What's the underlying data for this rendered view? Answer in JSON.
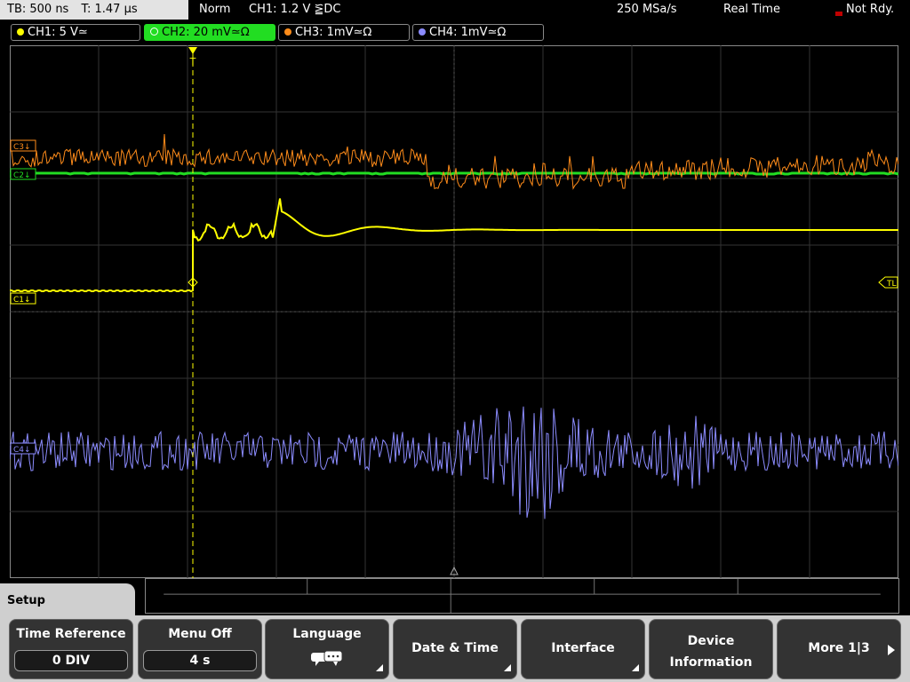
{
  "header": {
    "timebase": "TB: 500 ns",
    "trigger_time": "T: 1.47 µs",
    "mode": "Norm",
    "trigger": "CH1: 1.2 V ⪠DC",
    "sample_rate": "250 MSa/s",
    "acq_mode": "Real Time",
    "status": "Not Rdy."
  },
  "channels": [
    {
      "label": "CH1: 5 V≃",
      "color": "#ffff00"
    },
    {
      "label": "CH2: 20 mV≃Ω",
      "color": "#00ff00"
    },
    {
      "label": "CH3: 1mV≃Ω",
      "color": "#ff8c1a"
    },
    {
      "label": "CH4: 1mV≃Ω",
      "color": "#8c8cff"
    }
  ],
  "markers": {
    "c3": "C3↓",
    "c2": "C2↓",
    "c1": "C1↓",
    "c4": "C4↓",
    "tl": "TL",
    "trigger": "T"
  },
  "menu": {
    "title": "Setup",
    "softkeys": [
      {
        "label": "Time Reference",
        "value": "0 DIV"
      },
      {
        "label": "Menu Off",
        "value": "4 s"
      },
      {
        "label": "Language",
        "icon": "speech-bubbles-icon"
      },
      {
        "label": "Date & Time"
      },
      {
        "label": "Interface"
      },
      {
        "label_line1": "Device",
        "label_line2": "Information"
      },
      {
        "label": "More 1|3"
      }
    ]
  }
}
